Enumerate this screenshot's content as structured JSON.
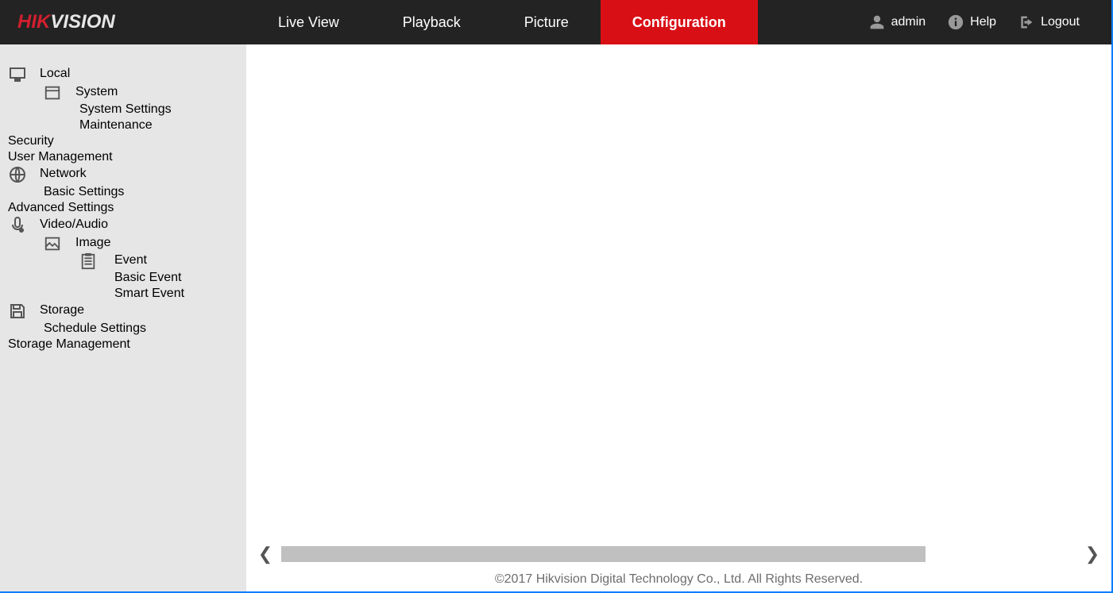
{
  "logo": {
    "part1": "HIK",
    "part2": "VISION"
  },
  "nav": {
    "items": [
      {
        "label": "Live View",
        "active": false
      },
      {
        "label": "Playback",
        "active": false
      },
      {
        "label": "Picture",
        "active": false
      },
      {
        "label": "Configuration",
        "active": true
      }
    ]
  },
  "topright": {
    "user": "admin",
    "help": "Help",
    "logout": "Logout"
  },
  "sidebar": {
    "local": "Local",
    "system": "System",
    "system_settings": "System Settings",
    "maintenance": "Maintenance",
    "security": "Security",
    "user_management": "User Management",
    "network": "Network",
    "basic_settings_net": "Basic Settings",
    "advanced_settings": "Advanced Settings",
    "video_audio": "Video/Audio",
    "image": "Image",
    "event": "Event",
    "basic_event": "Basic Event",
    "smart_event": "Smart Event",
    "storage": "Storage",
    "schedule_settings": "Schedule Settings",
    "storage_management": "Storage Management"
  },
  "footer": "©2017 Hikvision Digital Technology Co., Ltd. All Rights Reserved."
}
